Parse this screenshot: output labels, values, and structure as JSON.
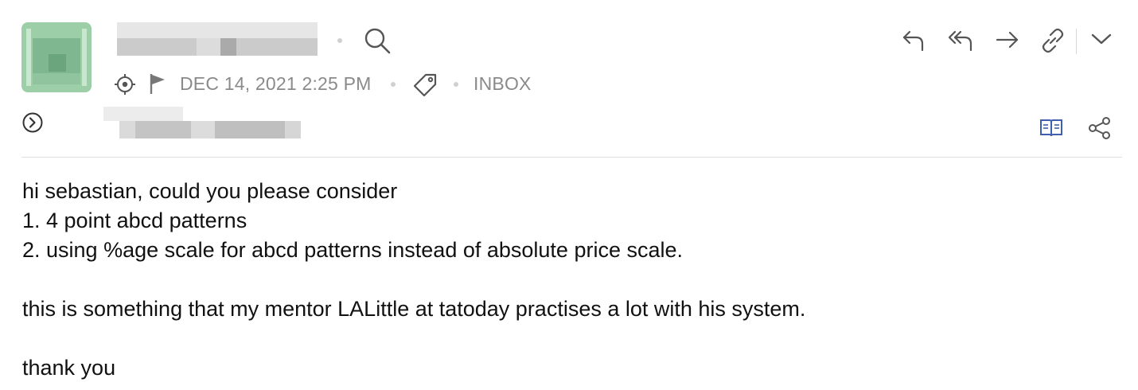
{
  "message": {
    "date": "DEC 14, 2021 2:25 PM",
    "folder": "INBOX",
    "body_lines": [
      "hi sebastian, could you please consider",
      "1. 4 point abcd patterns",
      "2. using %age scale for abcd patterns instead of absolute price scale.",
      "",
      "this is something that my mentor LALittle at tatoday practises a lot with his system.",
      "",
      "thank you"
    ]
  },
  "colors": {
    "avatar": "#9ccfa8",
    "reader_icon": "#3f5fae",
    "icon_gray": "#666666",
    "meta_text": "#8a8a8a"
  },
  "icons": {
    "header": [
      "search-icon"
    ],
    "meta": [
      "target-icon",
      "flag-icon",
      "tag-icon"
    ],
    "actions": [
      "reply-icon",
      "reply-all-icon",
      "forward-icon",
      "link-icon",
      "chevron-down-icon"
    ],
    "secondary": [
      "expand-circle-icon",
      "reader-view-icon",
      "share-icon"
    ]
  }
}
